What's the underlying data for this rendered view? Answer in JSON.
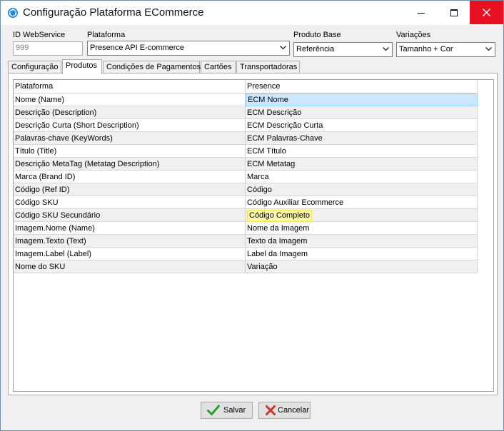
{
  "window": {
    "title": "Configuração Plataforma ECommerce",
    "icons": {
      "app": "app-logo-icon",
      "minimize": "minimize-icon",
      "maximize": "maximize-icon",
      "close": "close-icon"
    }
  },
  "form": {
    "id_webservice": {
      "label": "ID WebService",
      "value": "999"
    },
    "plataforma": {
      "label": "Plataforma",
      "value": "Presence API E-commerce"
    },
    "produto_base": {
      "label": "Produto Base",
      "value": "Referência"
    },
    "variacoes": {
      "label": "Variações",
      "value": "Tamanho + Cor"
    }
  },
  "tabs": [
    {
      "label": "Configuração"
    },
    {
      "label": "Produtos"
    },
    {
      "label": "Condições de Pagamentos"
    },
    {
      "label": "Cartões"
    },
    {
      "label": "Transportadoras"
    }
  ],
  "active_tab": "Produtos",
  "grid": {
    "headers": [
      "Plataforma",
      "Presence"
    ],
    "rows": [
      {
        "plataforma": "Nome (Name)",
        "presence": "ECM Nome"
      },
      {
        "plataforma": "Descrição (Description)",
        "presence": "ECM Descrição"
      },
      {
        "plataforma": "Descrição Curta (Short Description)",
        "presence": "ECM Descrição Curta"
      },
      {
        "plataforma": "Palavras-chave (KeyWords)",
        "presence": "ECM Palavras-Chave"
      },
      {
        "plataforma": "Título (Title)",
        "presence": "ECM Título"
      },
      {
        "plataforma": "Descrição MetaTag (Metatag Description)",
        "presence": "ECM Metatag"
      },
      {
        "plataforma": "Marca (Brand ID)",
        "presence": "Marca"
      },
      {
        "plataforma": "Código (Ref ID)",
        "presence": "Código"
      },
      {
        "plataforma": "Código SKU",
        "presence": "Código Auxiliar Ecommerce"
      },
      {
        "plataforma": "Código SKU Secundário",
        "presence": "Código Completo"
      },
      {
        "plataforma": "Imagem.Nome (Name)",
        "presence": "Nome da Imagem"
      },
      {
        "plataforma": "Imagem.Texto (Text)",
        "presence": "Texto da Imagem"
      },
      {
        "plataforma": "Imagem.Label (Label)",
        "presence": "Label da Imagem"
      },
      {
        "plataforma": "Nome do SKU",
        "presence": "Variação"
      }
    ]
  },
  "buttons": {
    "save": {
      "label": "Salvar",
      "icon": "checkmark-icon",
      "color": "#2e9e2e"
    },
    "cancel": {
      "label": "Cancelar",
      "icon": "cross-icon",
      "color": "#c0392b"
    }
  },
  "colors": {
    "selected_cell": "#cce8ff",
    "highlight": "#fff7a8",
    "close_button": "#e81123"
  }
}
